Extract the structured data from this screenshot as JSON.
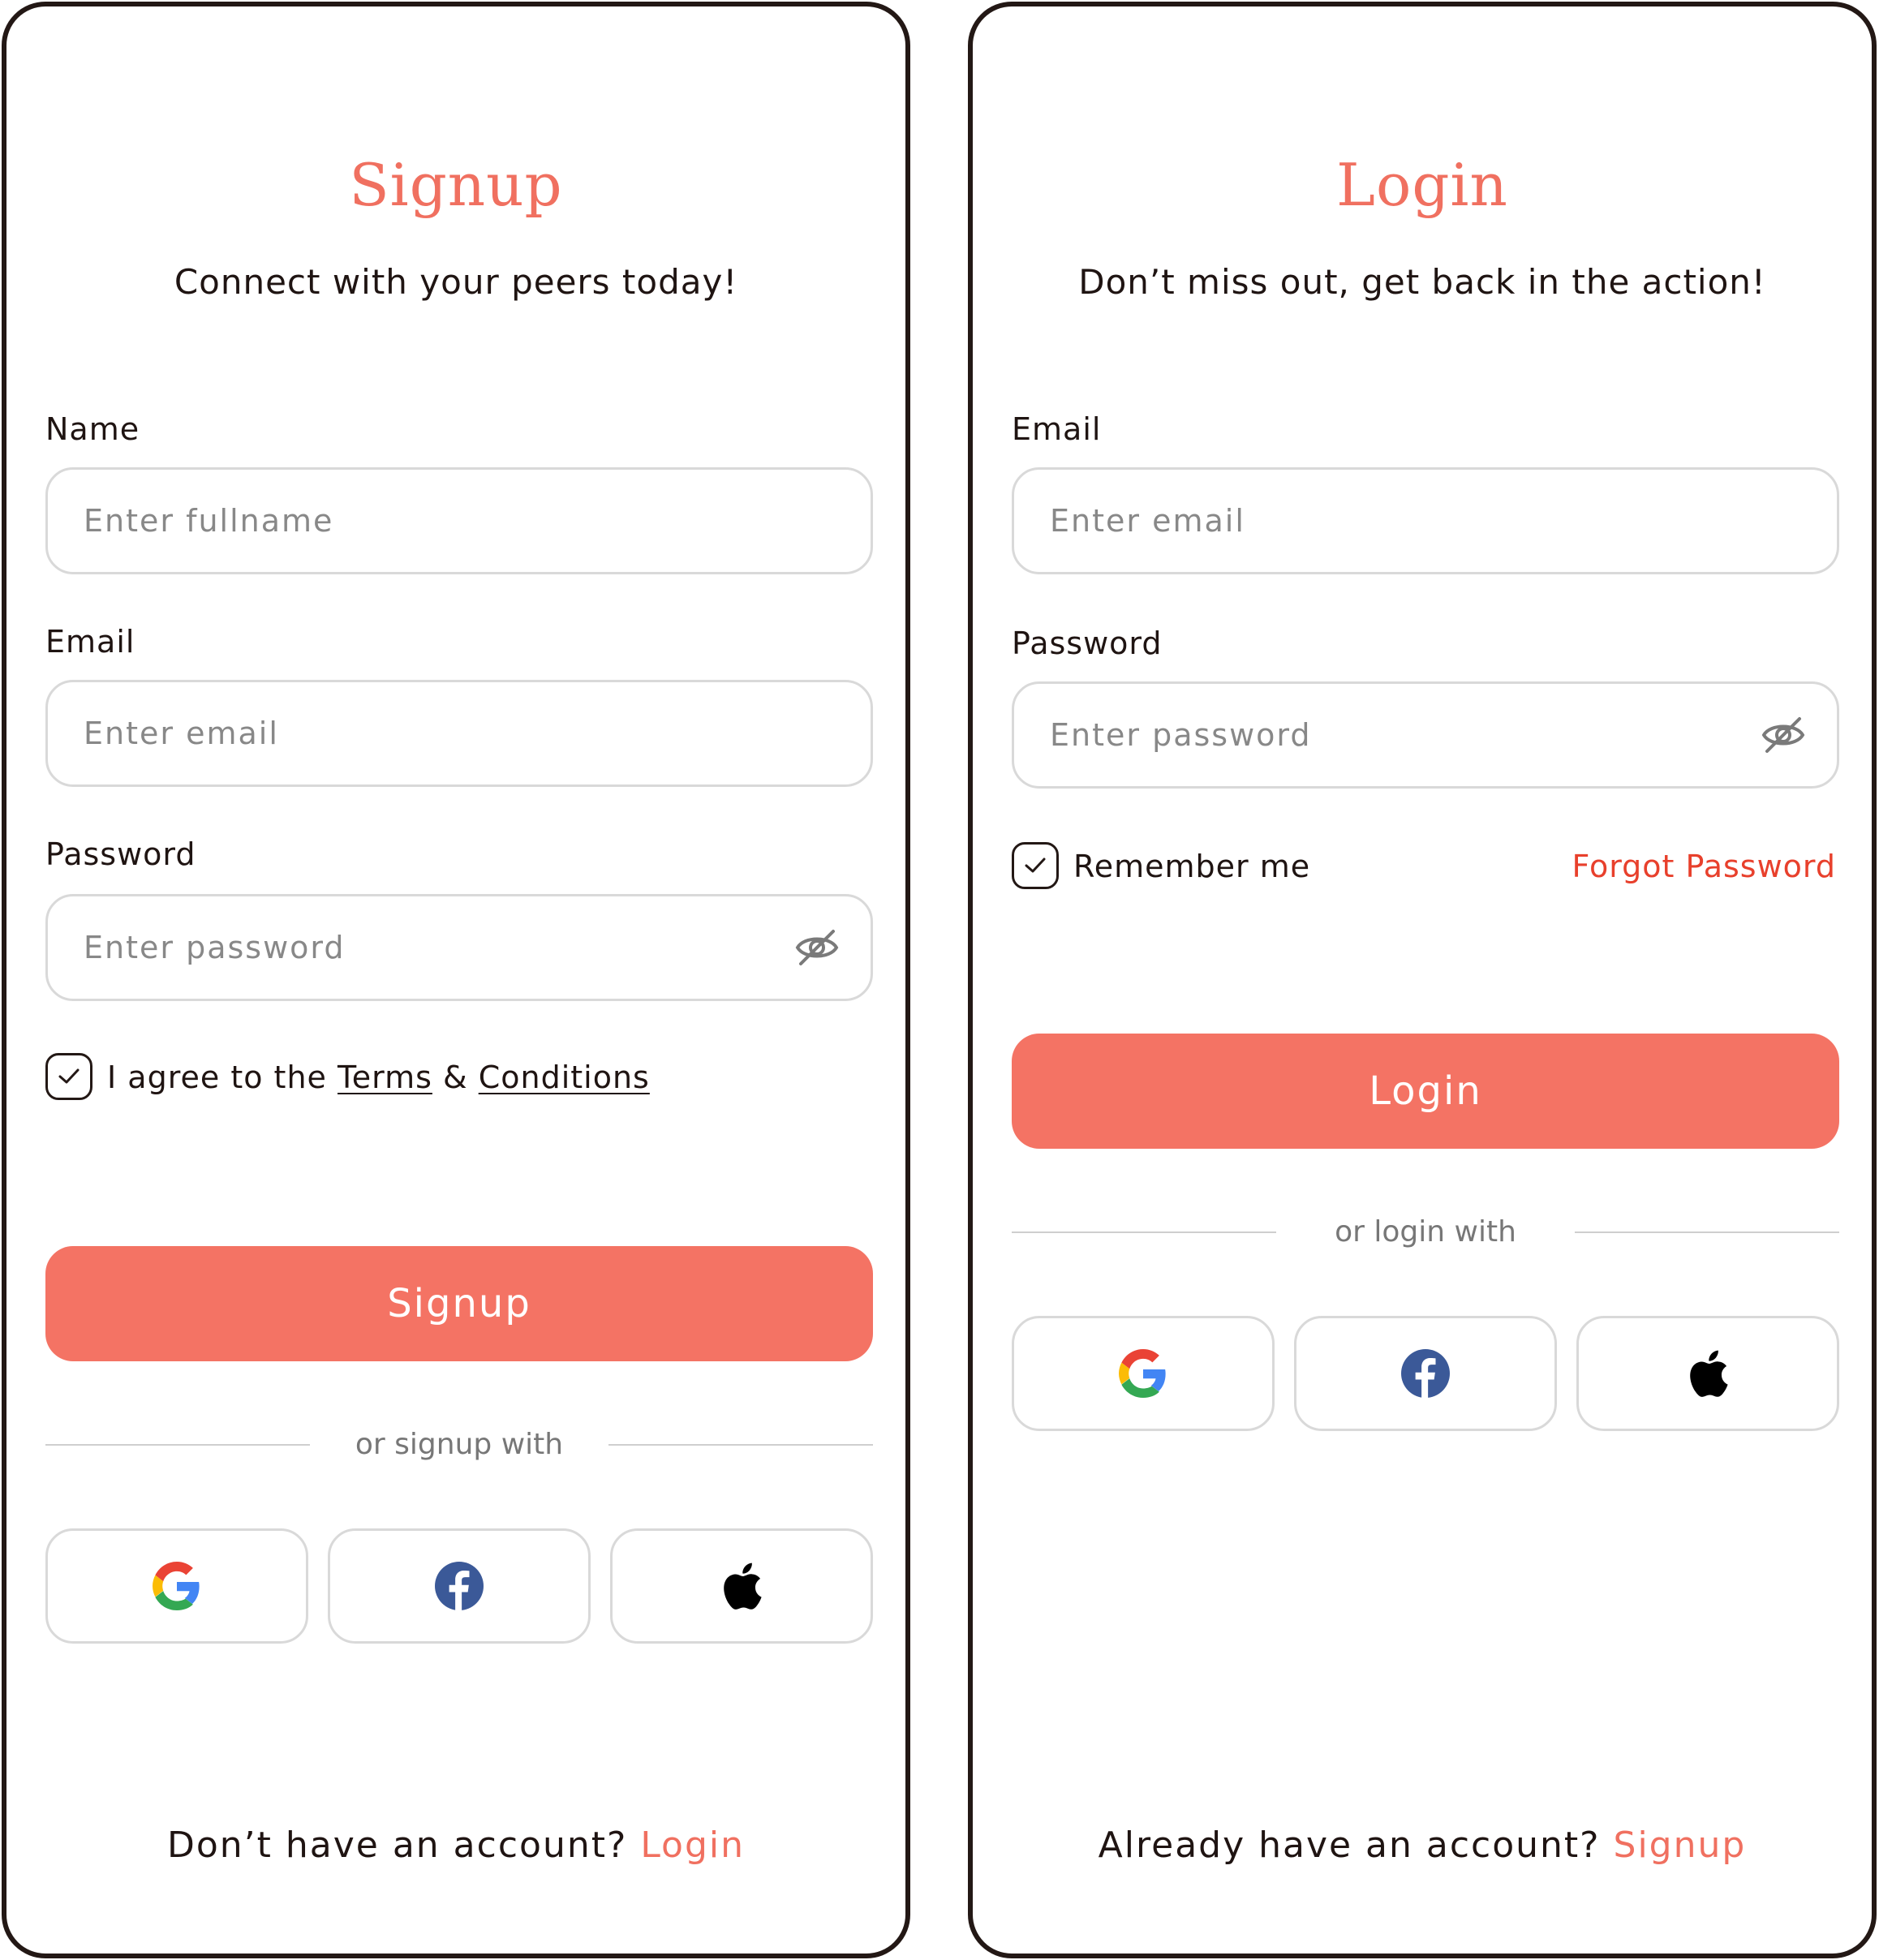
{
  "signup": {
    "title": "Signup",
    "subtitle": "Connect with your peers today!",
    "name_label": "Name",
    "name_placeholder": "Enter fullname",
    "email_label": "Email",
    "email_placeholder": "Enter email",
    "password_label": "Password",
    "password_placeholder": "Enter password",
    "agree_prefix": "I agree to the ",
    "terms_link": "Terms",
    "agree_amp": " & ",
    "conditions_link": "Conditions",
    "button_label": "Signup",
    "divider_text": "or signup with",
    "footer_text": "Don’t have an account? ",
    "footer_link": "Login"
  },
  "login": {
    "title": "Login",
    "subtitle": "Don’t miss out, get back in the action!",
    "email_label": "Email",
    "email_placeholder": "Enter email",
    "password_label": "Password",
    "password_placeholder": "Enter password",
    "remember_label": "Remember me",
    "forgot_link": "Forgot Password",
    "button_label": "Login",
    "divider_text": "or login with",
    "footer_text": "Already have an account? ",
    "footer_link": "Signup"
  },
  "social_icons": [
    "google-icon",
    "facebook-icon",
    "apple-icon"
  ],
  "colors": {
    "accent": "#f47364",
    "title": "#f07060",
    "forgot": "#e8402c",
    "facebook": "#3b5998"
  }
}
